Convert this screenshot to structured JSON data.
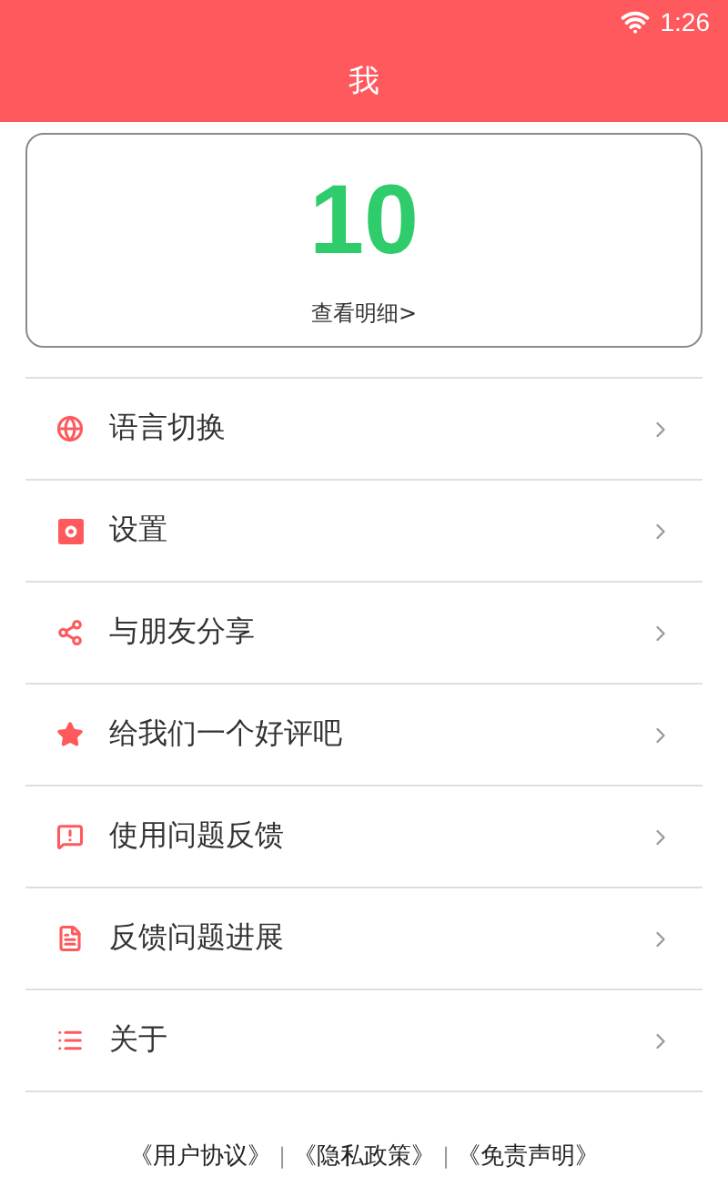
{
  "status_bar": {
    "time": "1:26"
  },
  "header": {
    "title": "我"
  },
  "points_card": {
    "value": "10",
    "link": "查看明细>"
  },
  "menu": [
    {
      "label": "语言切换"
    },
    {
      "label": "设置"
    },
    {
      "label": "与朋友分享"
    },
    {
      "label": "给我们一个好评吧"
    },
    {
      "label": "使用问题反馈"
    },
    {
      "label": "反馈问题进展"
    },
    {
      "label": "关于"
    }
  ],
  "footer": {
    "links": [
      {
        "kind": "link",
        "text": "《用户协议》"
      },
      {
        "kind": "separator",
        "text": "|"
      },
      {
        "kind": "link",
        "text": "《隐私政策》"
      },
      {
        "kind": "separator",
        "text": "|"
      },
      {
        "kind": "link",
        "text": "《免责声明》"
      }
    ]
  }
}
